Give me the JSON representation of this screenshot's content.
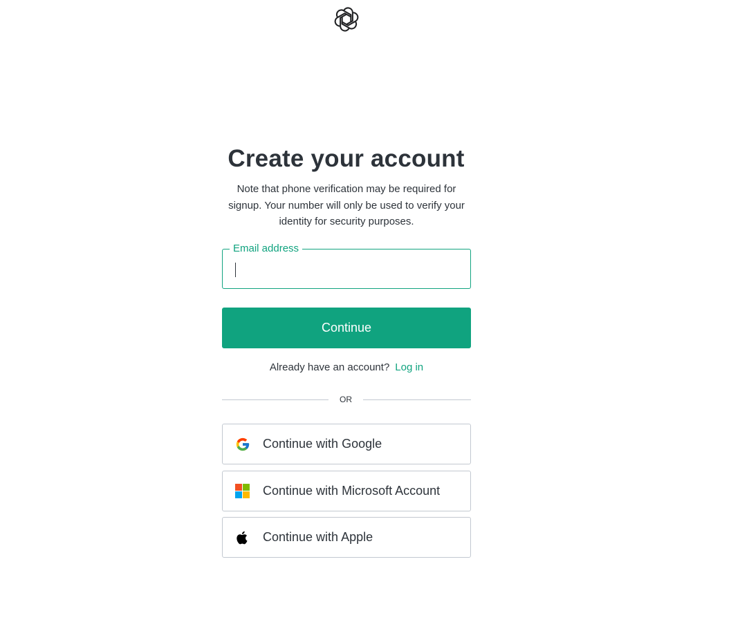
{
  "logo": {
    "icon": "openai-logo-icon"
  },
  "heading": {
    "title": "Create your account",
    "note": "Note that phone verification may be required for signup. Your number will only be used to verify your identity for security purposes."
  },
  "email": {
    "label": "Email address",
    "value": "",
    "placeholder": ""
  },
  "continue_button": {
    "label": "Continue"
  },
  "login": {
    "prompt": "Already have an account?",
    "link": "Log in"
  },
  "divider": {
    "text": "OR"
  },
  "social": [
    {
      "label": "Continue with Google",
      "icon": "google-icon"
    },
    {
      "label": "Continue with Microsoft Account",
      "icon": "microsoft-icon"
    },
    {
      "label": "Continue with Apple",
      "icon": "apple-icon"
    }
  ],
  "colors": {
    "accent": "#10a37f",
    "text": "#2d333a",
    "border": "#c2c8d0",
    "background": "#ffffff"
  }
}
